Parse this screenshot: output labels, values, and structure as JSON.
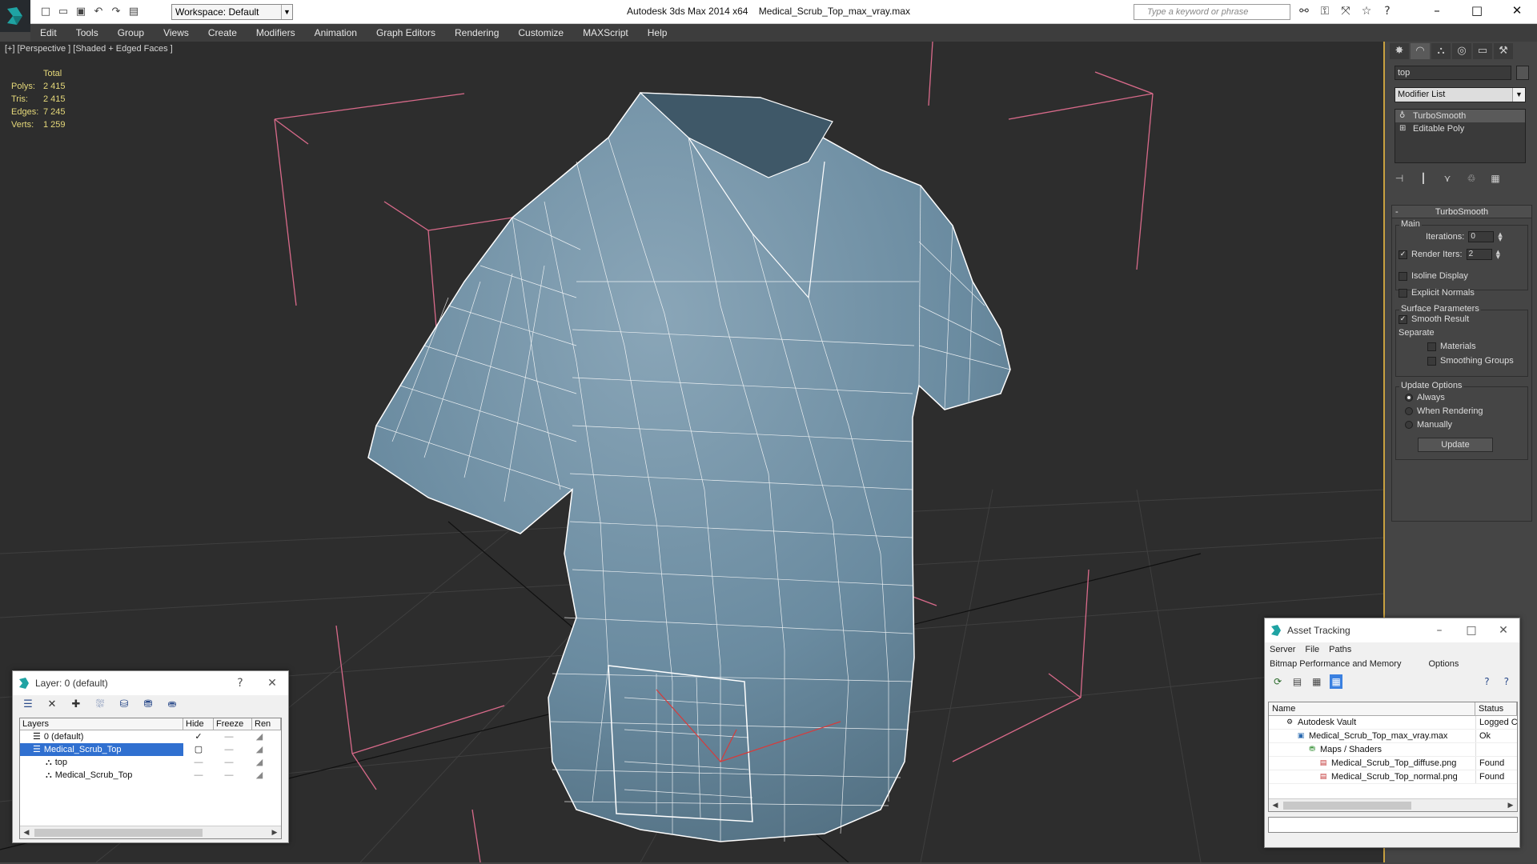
{
  "app": {
    "title": "Autodesk 3ds Max 2014 x64",
    "file": "Medical_Scrub_Top_max_vray.max",
    "workspace": "Workspace: Default",
    "search_placeholder": "Type a keyword or phrase"
  },
  "menu": [
    "Edit",
    "Tools",
    "Group",
    "Views",
    "Create",
    "Modifiers",
    "Animation",
    "Graph Editors",
    "Rendering",
    "Customize",
    "MAXScript",
    "Help"
  ],
  "viewport": {
    "label": "[+] [Perspective ] [Shaded + Edged Faces ]",
    "stats": {
      "header": "Total",
      "rows": [
        {
          "k": "Polys:",
          "v": "2 415"
        },
        {
          "k": "Tris:",
          "v": "2 415"
        },
        {
          "k": "Edges:",
          "v": "7 245"
        },
        {
          "k": "Verts:",
          "v": "1 259"
        }
      ]
    }
  },
  "command_panel": {
    "object_name": "top",
    "modifier_list": "Modifier List",
    "stack": [
      "TurboSmooth",
      "Editable Poly"
    ],
    "rollout": {
      "title": "TurboSmooth",
      "main": "Main",
      "iterations_label": "Iterations:",
      "iterations_value": "0",
      "render_iters_label": "Render Iters:",
      "render_iters_value": "2",
      "isoline": "Isoline Display",
      "explicit": "Explicit Normals",
      "surface": "Surface Parameters",
      "smooth_result": "Smooth Result",
      "separate": "Separate",
      "materials": "Materials",
      "smoothing_groups": "Smoothing Groups",
      "update_options": "Update Options",
      "always": "Always",
      "when_rendering": "When Rendering",
      "manually": "Manually",
      "update_button": "Update"
    }
  },
  "layer_panel": {
    "title": "Layer: 0 (default)",
    "help": "?",
    "columns": [
      "Layers",
      "Hide",
      "Freeze",
      "Ren"
    ],
    "rows": [
      {
        "name": "0 (default)",
        "indent": 0
      },
      {
        "name": "Medical_Scrub_Top",
        "indent": 0
      },
      {
        "name": "top",
        "indent": 1
      },
      {
        "name": "Medical_Scrub_Top",
        "indent": 1
      }
    ]
  },
  "asset_panel": {
    "title": "Asset Tracking",
    "menu1": [
      "Server",
      "File",
      "Paths"
    ],
    "menu2": [
      "Bitmap Performance and Memory",
      "Options"
    ],
    "columns": [
      "Name",
      "Status"
    ],
    "rows": [
      {
        "name": "Autodesk Vault",
        "status": "Logged C"
      },
      {
        "name": "Medical_Scrub_Top_max_vray.max",
        "status": "Ok"
      },
      {
        "name": "Maps / Shaders",
        "status": ""
      },
      {
        "name": "Medical_Scrub_Top_diffuse.png",
        "status": "Found"
      },
      {
        "name": "Medical_Scrub_Top_normal.png",
        "status": "Found"
      }
    ]
  },
  "colors": {
    "viewport_bg": "#2d2d2d",
    "mesh": "#6d8ea3",
    "wire": "#ffffff",
    "gizmo": "#d86a8a",
    "stats": "#e6d97a",
    "selection": "#3070d0"
  }
}
